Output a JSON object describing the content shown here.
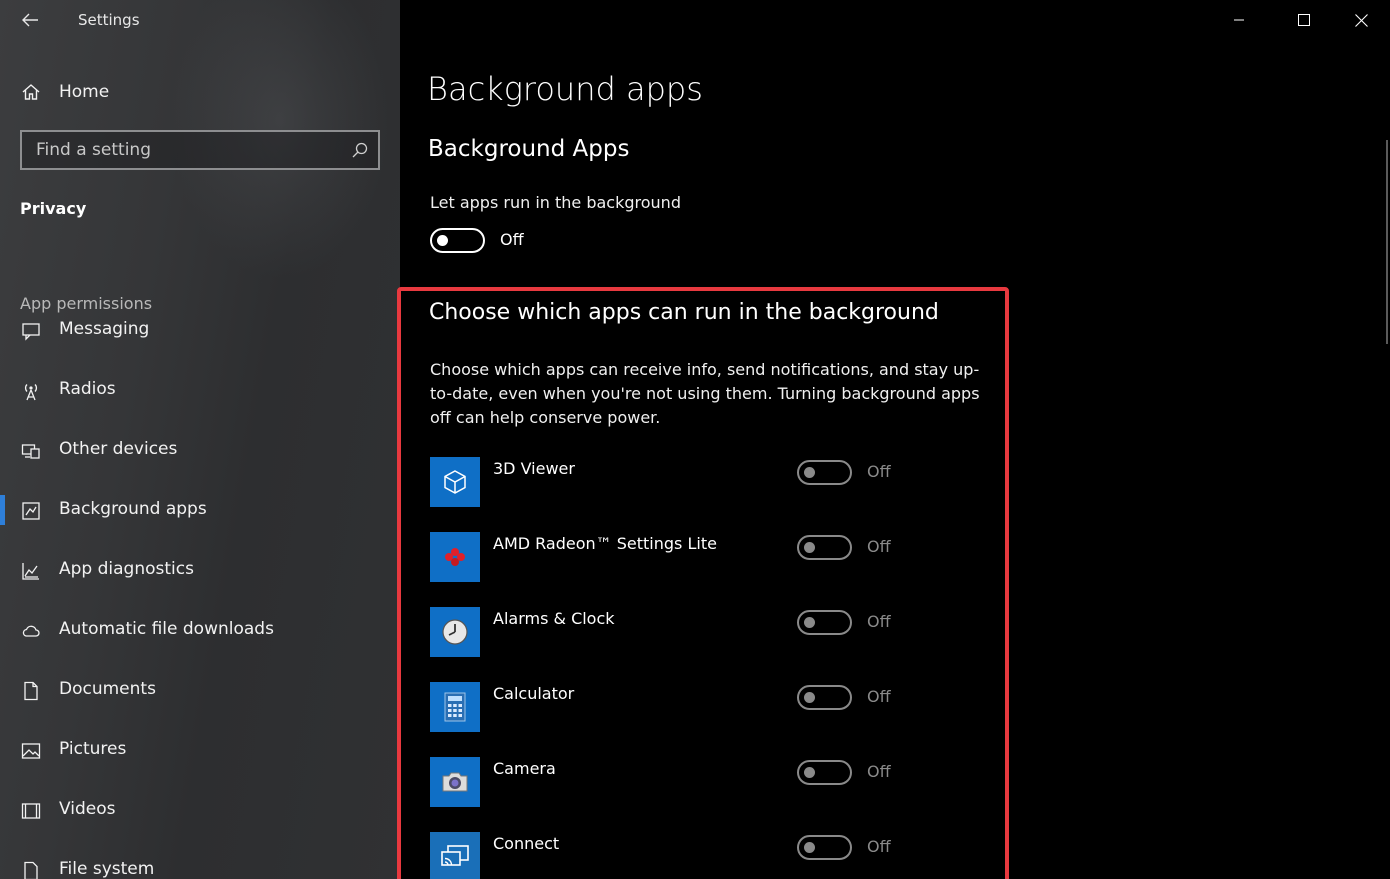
{
  "window": {
    "title": "Settings",
    "minimize_glyph": "—",
    "colors": {
      "accent": "#2e7fd9",
      "highlight": "#e8393f",
      "tile": "#0f6fc6"
    }
  },
  "sidebar": {
    "home_label": "Home",
    "search_placeholder": "Find a setting",
    "section_title": "Privacy",
    "group_title": "App permissions",
    "items": [
      {
        "label": "Messaging",
        "icon": "message-icon"
      },
      {
        "label": "Radios",
        "icon": "radio-tower-icon"
      },
      {
        "label": "Other devices",
        "icon": "devices-icon"
      },
      {
        "label": "Background apps",
        "icon": "background-apps-icon",
        "active": true
      },
      {
        "label": "App diagnostics",
        "icon": "diagnostics-chart-icon"
      },
      {
        "label": "Automatic file downloads",
        "icon": "cloud-icon"
      },
      {
        "label": "Documents",
        "icon": "document-icon"
      },
      {
        "label": "Pictures",
        "icon": "picture-icon"
      },
      {
        "label": "Videos",
        "icon": "video-icon"
      },
      {
        "label": "File system",
        "icon": "file-icon"
      }
    ]
  },
  "main": {
    "page_title": "Background apps",
    "section_title": "Background Apps",
    "run_label": "Let apps run in the background",
    "run_state": "Off",
    "choose_title": "Choose which apps can run in the background",
    "choose_desc": "Choose which apps can receive info, send notifications, and stay up-to-date, even when you're not using them. Turning background apps off can help conserve power.",
    "apps": [
      {
        "name": "3D Viewer",
        "state": "Off",
        "icon": "cube-icon"
      },
      {
        "name": "AMD Radeon™ Settings Lite",
        "state": "Off",
        "icon": "amd-radeon-icon"
      },
      {
        "name": "Alarms & Clock",
        "state": "Off",
        "icon": "clock-icon"
      },
      {
        "name": "Calculator",
        "state": "Off",
        "icon": "calculator-icon"
      },
      {
        "name": "Camera",
        "state": "Off",
        "icon": "camera-icon"
      },
      {
        "name": "Connect",
        "state": "Off",
        "icon": "connect-icon"
      }
    ]
  }
}
